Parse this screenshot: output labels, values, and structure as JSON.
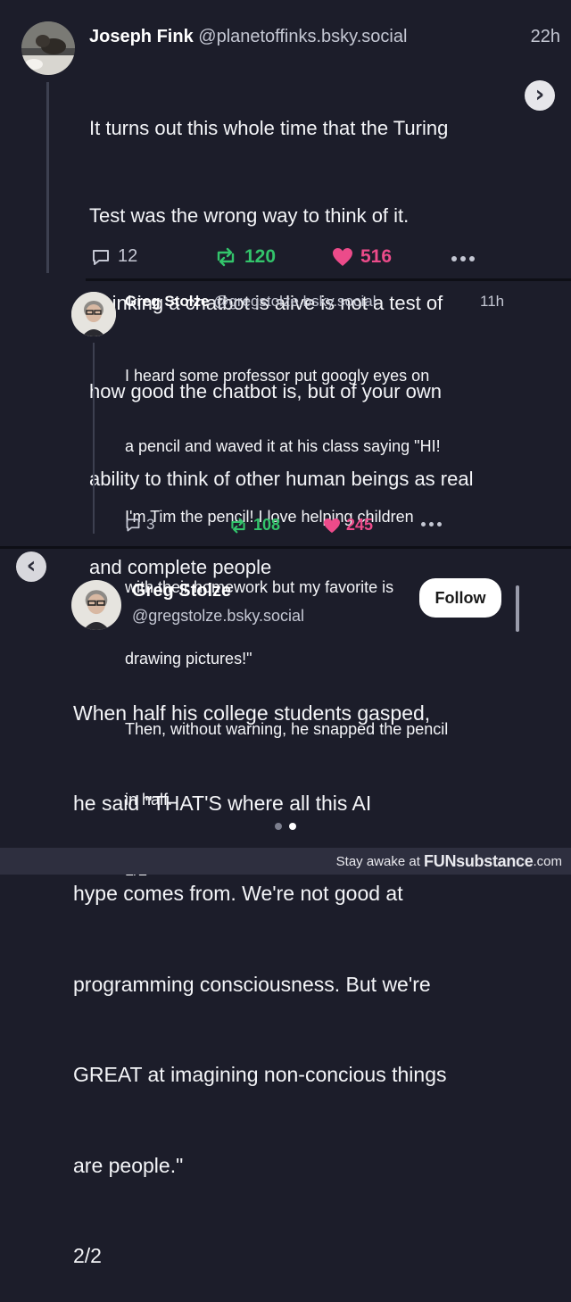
{
  "post1": {
    "author_name": "Joseph Fink",
    "author_handle": "@planetoffinks.bsky.social",
    "time": "22h",
    "text_lines": [
      "It turns out this whole time that the Turing",
      "Test was the wrong way to think of it.",
      "Thinking a chatbot is alive is not a test of",
      "how good the chatbot is, but of your own",
      "ability to think of other human beings as real",
      "and complete people"
    ],
    "replies": "12",
    "reposts": "120",
    "likes": "516"
  },
  "post2": {
    "author_name": "Greg Stolze",
    "author_handle": "@gregstolze.bsky.social",
    "time": "11h",
    "text_lines": [
      "I heard some professor put googly eyes on",
      "a pencil and waved it at his class saying \"HI!",
      "I'm Tim the pencil! I love helping children",
      "with their homework but my favorite is",
      "drawing pictures!\"",
      "Then, without warning, he snapped the pencil",
      "in half.",
      "1/2"
    ],
    "replies": "3",
    "reposts": "108",
    "likes": "245"
  },
  "post3": {
    "author_name": "Greg Stolze",
    "author_handle": "@gregstolze.bsky.social",
    "follow_label": "Follow",
    "text_lines": [
      "When half his college students gasped,",
      "he said \"THAT'S where all this AI",
      "hype comes from. We're not good at",
      "programming consciousness. But we're",
      "GREAT at imagining non-concious things",
      "are people.\"",
      "2/2"
    ]
  },
  "navigation": {
    "next_glyph": "›",
    "prev_glyph": "‹"
  },
  "footer": {
    "prefix": "Stay awake at",
    "brand": "FUNsubstance",
    "suffix": ".com"
  },
  "colors": {
    "background": "#1c1d2a",
    "repost": "#33c46b",
    "like": "#ec4b8a",
    "muted": "#c4c7d3"
  },
  "icons": [
    "reply-icon",
    "repost-icon",
    "heart-icon",
    "more-icon",
    "chevron-right-icon",
    "chevron-left-icon"
  ]
}
